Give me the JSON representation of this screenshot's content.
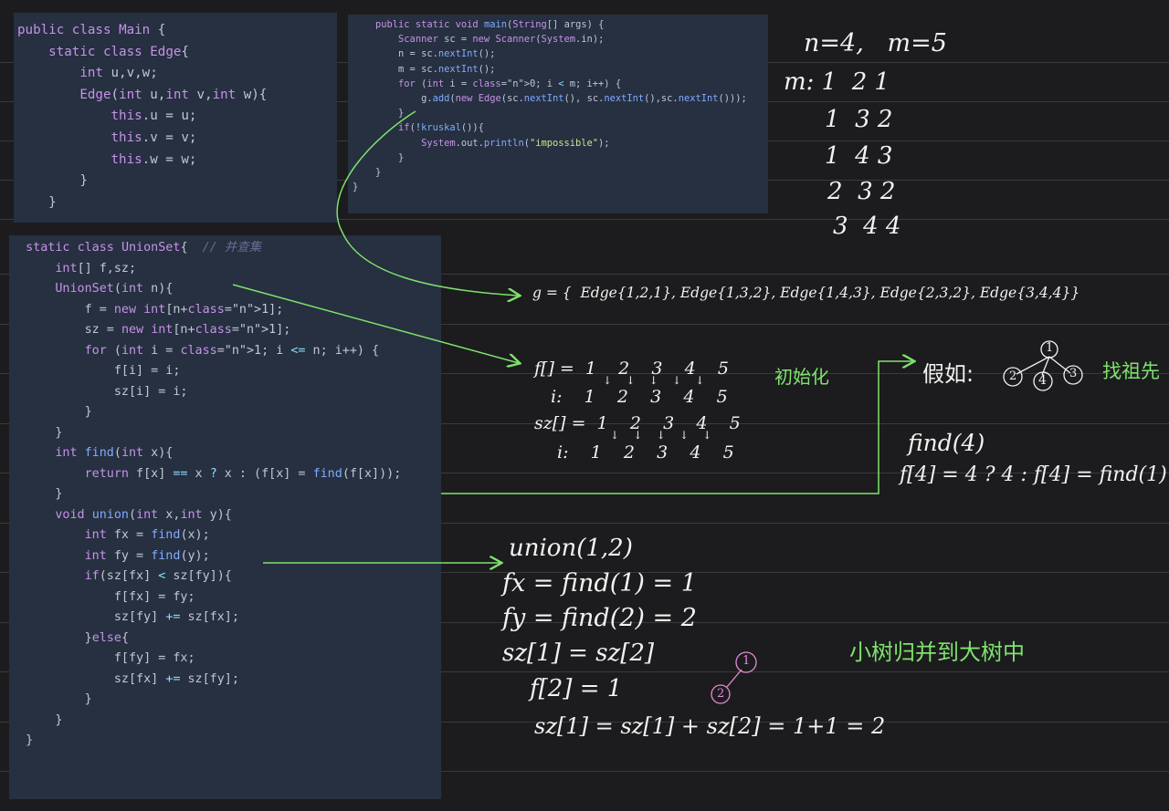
{
  "code_main": [
    "public class Main {",
    "    static class Edge{",
    "        int u,v,w;",
    "        Edge(int u,int v,int w){",
    "            this.u = u;",
    "            this.v = v;",
    "            this.w = w;",
    "        }",
    "    }"
  ],
  "code_main_method": [
    "    public static void main(String[] args) {",
    "        Scanner sc = new Scanner(System.in);",
    "",
    "        n = sc.nextInt();",
    "        m = sc.nextInt();",
    "        for (int i = 0; i < m; i++) {",
    "            g.add(new Edge(sc.nextInt(), sc.nextInt(),sc.nextInt()));",
    "        }",
    "        if(!kruskal()){",
    "            System.out.println(\"impossible\");",
    "        }",
    "    }",
    "}"
  ],
  "code_unionset": [
    "  static class UnionSet{  // 并查集",
    "      int[] f,sz;",
    "      UnionSet(int n){",
    "          f = new int[n+1];",
    "          sz = new int[n+1];",
    "          for (int i = 1; i <= n; i++) {",
    "              f[i] = i;",
    "              sz[i] = i;",
    "          }",
    "      }",
    "",
    "      int find(int x){",
    "          return f[x] == x ? x : (f[x] = find(f[x]));",
    "      }",
    "",
    "      void union(int x,int y){",
    "          int fx = find(x);",
    "          int fy = find(y);",
    "          if(sz[fx] < sz[fy]){",
    "              f[fx] = fy;",
    "              sz[fy] += sz[fx];",
    "          }else{",
    "              f[fy] = fx;",
    "              sz[fx] += sz[fy];",
    "          }",
    "      }",
    "  }"
  ],
  "notes": {
    "nm": "n=4,   m=5",
    "input_rows": [
      "m: 1  2 1",
      "1  3 2",
      "1  4 3",
      "2  3 2",
      "3  4 4"
    ],
    "g_line": "g = {  Edge{1,2,1}, Edge{1,3,2}, Edge{1,4,3}, Edge{2,3,2}, Edge{3,4,4}}",
    "f_row": "f[] =  1    2    3    4    5",
    "f_arrows": "↓    ↓    ↓    ↓    ↓",
    "f_i_row": "i:    1    2    3    4    5",
    "sz_row": "sz[] =  1    2    3    4    5",
    "sz_arrows": "↓    ↓    ↓    ↓    ↓",
    "sz_i_row": "i:    1    2    3    4    5",
    "init_label": "初始化",
    "assume_label": "假如:",
    "find_ancestor_label": "找祖先",
    "tree_nodes": [
      "1",
      "2",
      "4",
      "3"
    ],
    "find4": "find(4)",
    "find4_expr": "f[4] = 4 ? 4 : f[4] = find(1)",
    "union12": "union(1,2)",
    "fx_line": "fx = find(1) = 1",
    "fy_line": "fy = find(2) = 2",
    "sz_eq": "sz[1] = sz[2]",
    "f2_line": "f[2] = 1",
    "sz_sum": "sz[1] = sz[1] + sz[2] = 1+1 = 2",
    "merge_label": "小树归并到大树中",
    "small_tree_nodes": [
      "1",
      "2"
    ]
  },
  "colors": {
    "background": "#1c1c1e",
    "panel": "#263040",
    "handwriting": "#f2f2f2",
    "green_annotation": "#7ee36c",
    "pink_annotation": "#e58ad8"
  }
}
